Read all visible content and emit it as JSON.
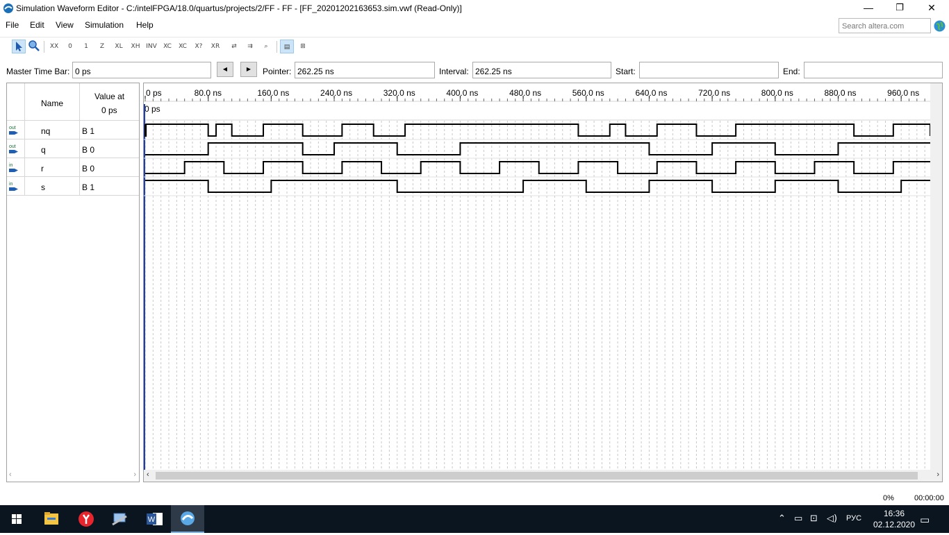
{
  "window": {
    "title": "Simulation Waveform Editor - C:/intelFPGA/18.0/quartus/projects/2/FF - FF - [FF_20201202163653.sim.vwf (Read-Only)]",
    "minimize": "—",
    "maximize": "❐",
    "close": "✕"
  },
  "menu": {
    "items": [
      "File",
      "Edit",
      "View",
      "Simulation",
      "Help"
    ]
  },
  "search": {
    "placeholder": "Search altera.com"
  },
  "toolbar": {
    "icons": [
      "selection-tool",
      "zoom-tool",
      "forcing-unknown",
      "forcing-low",
      "forcing-high",
      "high-impedance",
      "weak-low",
      "weak-high",
      "invert",
      "count-value",
      "clock-value",
      "arbitrary-value",
      "random-value",
      "snap-to-grid",
      "grid-settings",
      "find",
      "replace",
      "waveform-view",
      "grid-view"
    ]
  },
  "timebar": {
    "master_label": "Master Time Bar:",
    "master_value": "0 ps",
    "pointer_label": "Pointer:",
    "pointer_value": "262.25 ns",
    "interval_label": "Interval:",
    "interval_value": "262.25 ns",
    "start_label": "Start:",
    "start_value": "",
    "end_label": "End:",
    "end_value": ""
  },
  "names": {
    "header_name": "Name",
    "header_value_line1": "Value at",
    "header_value_line2": "0 ps"
  },
  "signals": [
    {
      "dir": "out",
      "name": "nq",
      "value": "B 1"
    },
    {
      "dir": "out",
      "name": "q",
      "value": "B 0"
    },
    {
      "dir": "in",
      "name": "r",
      "value": "B 0"
    },
    {
      "dir": "in",
      "name": "s",
      "value": "B 1"
    }
  ],
  "chart_data": {
    "type": "line",
    "x_unit": "ns",
    "xlim": [
      0,
      1000
    ],
    "tick_labels": [
      "0 ps",
      "80.0 ns",
      "160.0 ns",
      "240.0 ns",
      "320.0 ns",
      "400.0 ns",
      "480.0 ns",
      "560.0 ns",
      "640.0 ns",
      "720.0 ns",
      "800.0 ns",
      "880.0 ns",
      "960.0 ns"
    ],
    "master_marker_label": "0 ps",
    "series": [
      {
        "name": "nq",
        "transitions_ns": [
          0,
          1,
          80,
          90,
          110,
          150,
          200,
          250,
          290,
          330,
          550,
          590,
          610,
          650,
          700,
          750,
          900,
          950,
          1000
        ],
        "initial": 1
      },
      {
        "name": "q",
        "transitions_ns": [
          80,
          200,
          240,
          320,
          400,
          640,
          720,
          800,
          880
        ],
        "initial": 0
      },
      {
        "name": "r",
        "transitions_ns": [
          50,
          100,
          150,
          200,
          250,
          300,
          350,
          400,
          450,
          500,
          550,
          600,
          650,
          700,
          750,
          800,
          850,
          900,
          950
        ],
        "initial": 0
      },
      {
        "name": "s",
        "transitions_ns": [
          80,
          160,
          320,
          480,
          560,
          640,
          720,
          800,
          880,
          960
        ],
        "initial": 1
      }
    ]
  },
  "status": {
    "progress": "0%",
    "elapsed": "00:00:00"
  },
  "taskbar": {
    "apps": [
      "windows-start",
      "file-explorer",
      "yandex-browser",
      "network-tool",
      "word",
      "quartus"
    ],
    "lang": "РУС",
    "time": "16:36",
    "date": "02.12.2020"
  }
}
